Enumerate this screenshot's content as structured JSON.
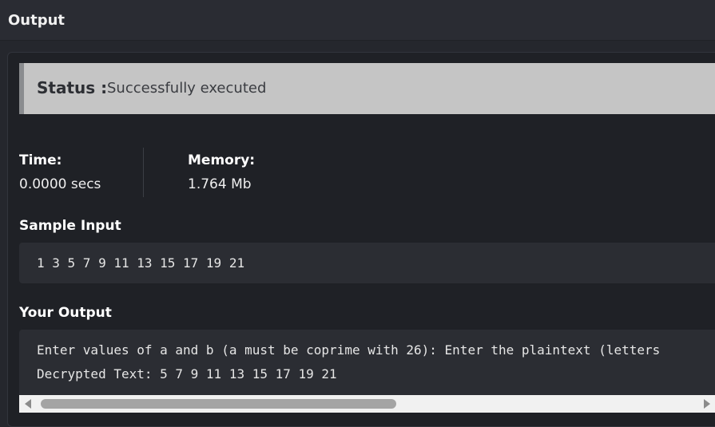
{
  "header": {
    "title": "Output"
  },
  "status": {
    "label": "Status :",
    "value": "Successfully executed"
  },
  "metrics": {
    "time_label": "Time:",
    "time_value": "0.0000 secs",
    "memory_label": "Memory:",
    "memory_value": "1.764 Mb"
  },
  "sample_input": {
    "title": "Sample Input",
    "text": "1 3 5 7 9 11 13 15 17 19 21"
  },
  "your_output": {
    "title": "Your Output",
    "lines": [
      "Enter values of a and b (a must be coprime with 26): Enter the plaintext (letters",
      "Decrypted Text: 5 7 9 11 13 15 17 19 21"
    ]
  },
  "scrollbar": {
    "position_fraction": 0.0
  },
  "colors": {
    "background": "#25272d",
    "status_bar": "#c5c5c5",
    "status_accent": "#8a8c8f",
    "code_box": "#2b2d33"
  },
  "icons": {
    "scroll_left": "triangle-left-icon",
    "scroll_right": "triangle-right-icon"
  }
}
